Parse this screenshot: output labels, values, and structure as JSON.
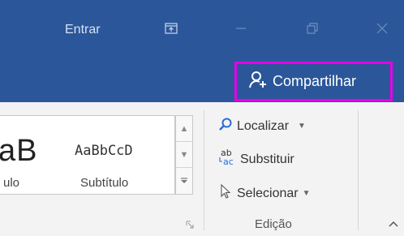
{
  "titlebar": {
    "signin_label": "Entrar",
    "ribbon_display_icon": "ribbon-display-options-icon",
    "minimize_icon": "minimize-icon",
    "restore_icon": "restore-icon",
    "close_icon": "close-icon"
  },
  "share": {
    "label": "Compartilhar",
    "icon": "person-add-icon",
    "highlight_color": "#e600e6"
  },
  "styles": {
    "preview_1": "aB",
    "label_1": "ulo",
    "preview_2": "AaBbCcD",
    "label_2": "Subtítulo"
  },
  "editing": {
    "find_label": "Localizar",
    "replace_label": "Substituir",
    "select_label": "Selecionar",
    "group_label": "Edição"
  },
  "colors": {
    "title_bar": "#2b579a",
    "ribbon": "#f3f3f3"
  }
}
